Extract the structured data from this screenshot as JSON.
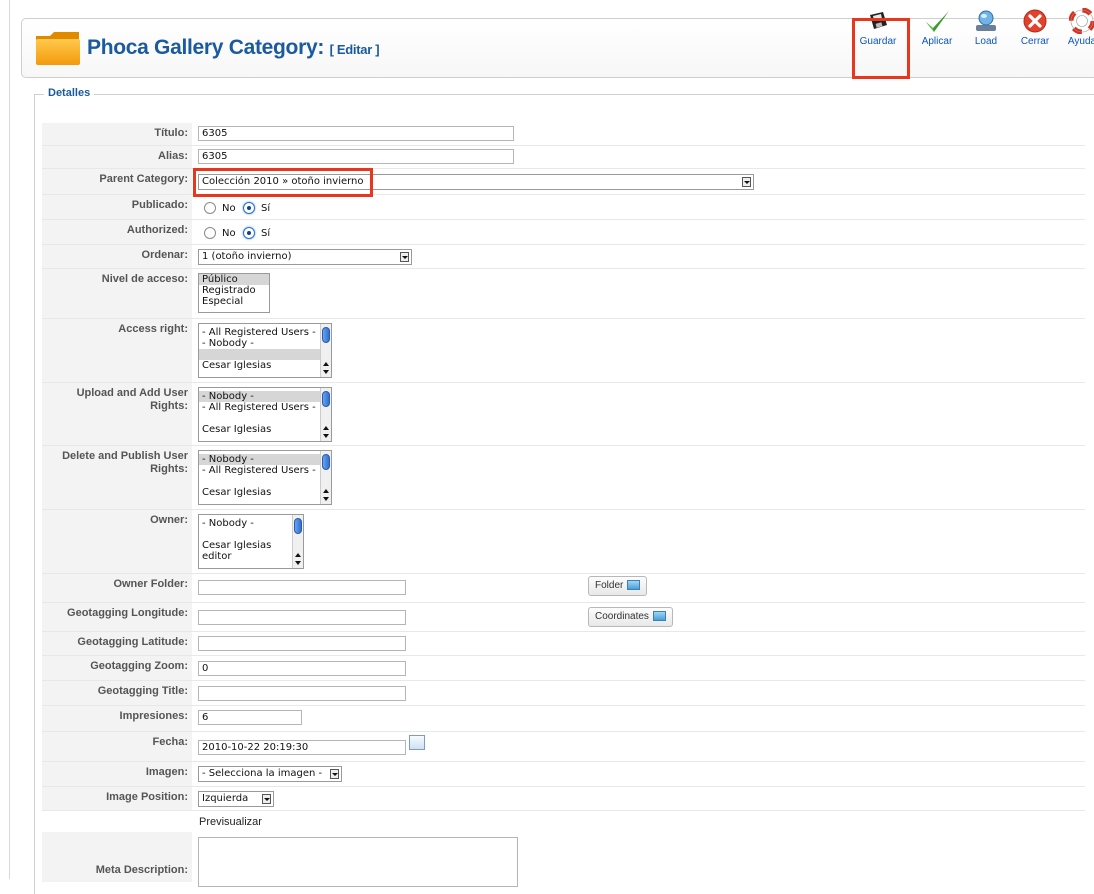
{
  "header": {
    "title": "Phoca Gallery Category:",
    "task": "[ Editar ]"
  },
  "toolbar": [
    {
      "label": "Guardar",
      "icon": "save-floppy-icon"
    },
    {
      "label": "Aplicar",
      "icon": "apply-check-icon"
    },
    {
      "label": "Load",
      "icon": "load-globe-icon"
    },
    {
      "label": "Cerrar",
      "icon": "close-x-icon"
    },
    {
      "label": "Ayuda",
      "icon": "help-lifebuoy-icon"
    }
  ],
  "highlight_color": "#e8371c",
  "title_color": "#1a5a9e",
  "form": {
    "legend": "Detalles",
    "titulo": {
      "label": "Título:",
      "value": "6305"
    },
    "alias": {
      "label": "Alias:",
      "value": "6305"
    },
    "parent": {
      "label": "Parent Category:",
      "value": "Colección 2010 » otoño invierno"
    },
    "publicado": {
      "label": "Publicado:",
      "no": "No",
      "si": "Sí",
      "selected": "Sí"
    },
    "authorized": {
      "label": "Authorized:",
      "no": "No",
      "si": "Sí",
      "selected": "Sí"
    },
    "ordenar": {
      "label": "Ordenar:",
      "value": "1 (otoño invierno)"
    },
    "nivel": {
      "label": "Nivel de acceso:",
      "options": [
        "Público",
        "Registrado",
        "Especial"
      ]
    },
    "access_right": {
      "label": "Access right:",
      "options": [
        "- All Registered Users -",
        "- Nobody -",
        "",
        "Cesar Iglesias"
      ]
    },
    "upload_rights": {
      "label": "Upload and Add User Rights:",
      "options": [
        "- Nobody -",
        "- All Registered Users -",
        "",
        "Cesar Iglesias"
      ]
    },
    "delete_rights": {
      "label": "Delete and Publish User Rights:",
      "options": [
        "- Nobody -",
        "- All Registered Users -",
        "",
        "Cesar Iglesias"
      ]
    },
    "owner": {
      "label": "Owner:",
      "options": [
        "- Nobody -",
        "",
        "Cesar Iglesias",
        "editor"
      ]
    },
    "owner_folder": {
      "label": "Owner Folder:",
      "value": "",
      "button": "Folder"
    },
    "geo_long": {
      "label": "Geotagging Longitude:",
      "value": "",
      "button": "Coordinates"
    },
    "geo_lat": {
      "label": "Geotagging Latitude:",
      "value": ""
    },
    "geo_zoom": {
      "label": "Geotagging Zoom:",
      "value": "0"
    },
    "geo_title": {
      "label": "Geotagging Title:",
      "value": ""
    },
    "impresiones": {
      "label": "Impresiones:",
      "value": "6"
    },
    "fecha": {
      "label": "Fecha:",
      "value": "2010-10-22 20:19:30"
    },
    "imagen": {
      "label": "Imagen:",
      "value": "- Selecciona la imagen -"
    },
    "image_position": {
      "label": "Image Position:",
      "value": "Izquierda"
    },
    "previsualizar": "Previsualizar",
    "meta_description": {
      "label": "Meta Description:",
      "value": ""
    }
  }
}
